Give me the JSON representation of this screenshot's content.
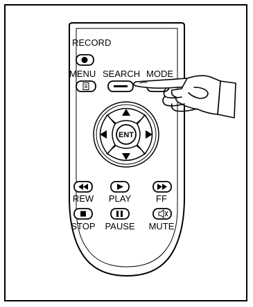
{
  "remote": {
    "labels": {
      "record": "RECORD",
      "menu": "MENU",
      "search": "SEARCH",
      "mode": "MODE",
      "ent": "ENT",
      "rew": "REW",
      "play": "PLAY",
      "ff": "FF",
      "stop": "STOP",
      "pause": "PAUSE",
      "mute": "MUTE"
    },
    "icons": {
      "record": "filled-circle-icon",
      "menu": "document-icon",
      "search": "dash-icon",
      "up": "triangle-up-icon",
      "down": "triangle-down-icon",
      "left": "triangle-left-icon",
      "right": "triangle-right-icon",
      "rew": "rewind-icon",
      "play": "play-icon",
      "ff": "fast-forward-icon",
      "stop": "stop-icon",
      "pause": "pause-icon",
      "mute": "mute-speaker-icon"
    },
    "pointer": "pointing-hand-icon"
  }
}
